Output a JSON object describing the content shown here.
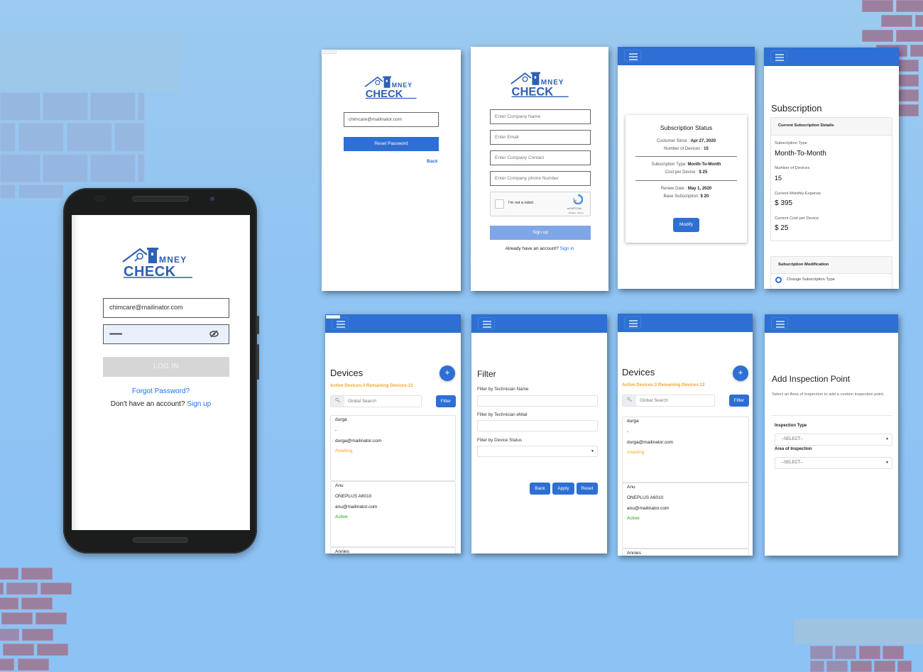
{
  "brand": {
    "logo_text_top": "MNEY",
    "logo_text_bottom": "CHECK",
    "logo_color": "#2d5fb4"
  },
  "colors": {
    "primary": "#2d6fd4",
    "warning": "#f5a623",
    "success": "#1aa01a",
    "link": "#1a73e8",
    "background": "#8ec3f3"
  },
  "phone_login": {
    "email_value": "chimcare@mailinator.com",
    "password_value": "••••••••••••",
    "password_toggle_icon": "eye-off-icon",
    "login_label": "LOG IN",
    "forgot_password": "Forgot Password?",
    "no_account_text": "Don't have an account?",
    "signup_link": "Sign up"
  },
  "reset_password": {
    "email_value": "chimcare@mailinator.com",
    "reset_button": "Reset Password",
    "back_link": "Back"
  },
  "signup": {
    "company_name_placeholder": "Enter Company Name",
    "email_placeholder": "Enter Email",
    "company_contact_placeholder": "Enter Company Contact",
    "company_phone_placeholder": "Enter Company phone Number",
    "captcha_label": "I'm not a robot",
    "captcha_brand": "reCAPTCHA",
    "captcha_links": "Privacy - Terms",
    "signup_button": "Sign up",
    "have_account_text": "Already have an account?",
    "signin_link": "Sign in"
  },
  "subscription_status": {
    "title": "Subscription Status",
    "customer_since_label": "Customer Since :",
    "customer_since_value": "Apr 27, 2020",
    "devices_label": "Number of Devices :",
    "devices_value": "15",
    "type_label": "Subscription Type:",
    "type_value": "Month-To-Month",
    "cost_label": "Cost per Device :",
    "cost_value": "$ 25",
    "renew_label": "Renew Date :",
    "renew_value": "May 1, 2020",
    "base_label": "Base Subscription:",
    "base_value": "$ 20",
    "modify_button": "Modify"
  },
  "subscription": {
    "title": "Subscription",
    "details_header": "Current Subscription Details",
    "type_label": "Subscription Type",
    "type_value": "Month-To-Month",
    "devices_label": "Number of Devices",
    "devices_value": "15",
    "monthly_label": "Current Monthly Expense",
    "monthly_value": "$ 395",
    "cost_label": "Current Cost per Device",
    "cost_value": "$ 25",
    "modification_header": "Subscription Modification",
    "change_type_option": "Change Subscription Type"
  },
  "devices": {
    "title": "Devices",
    "counter": "Active Devices:3 Remaining Devices:12",
    "add_icon": "+",
    "search_placeholder": "Global Search",
    "filter_button": "Filter",
    "items": [
      {
        "name": "durga",
        "model": "-",
        "email": "durga@mailinator.com",
        "status": "Awaiting"
      },
      {
        "name": "Anu",
        "model": "ONEPLUS A6010",
        "email": "anu@mailinator.com",
        "status": "Active"
      },
      {
        "name": "Annies",
        "model": "",
        "email": "",
        "status": ""
      }
    ]
  },
  "filter": {
    "title": "Filter",
    "tech_name_label": "Filter by Technician Name",
    "tech_email_label": "Filter by Technician eMail",
    "status_label": "Filter by Device Status",
    "back_button": "Back",
    "apply_button": "Apply",
    "reset_button": "Reset"
  },
  "add_inspection": {
    "title": "Add Inspection Point",
    "description": "Select an Area of Inspection to add a custom inspection point.",
    "type_label": "Inspection Type",
    "type_value": "--SELECT--",
    "area_label": "Area of Inspection",
    "area_value": "--SELECT--"
  }
}
